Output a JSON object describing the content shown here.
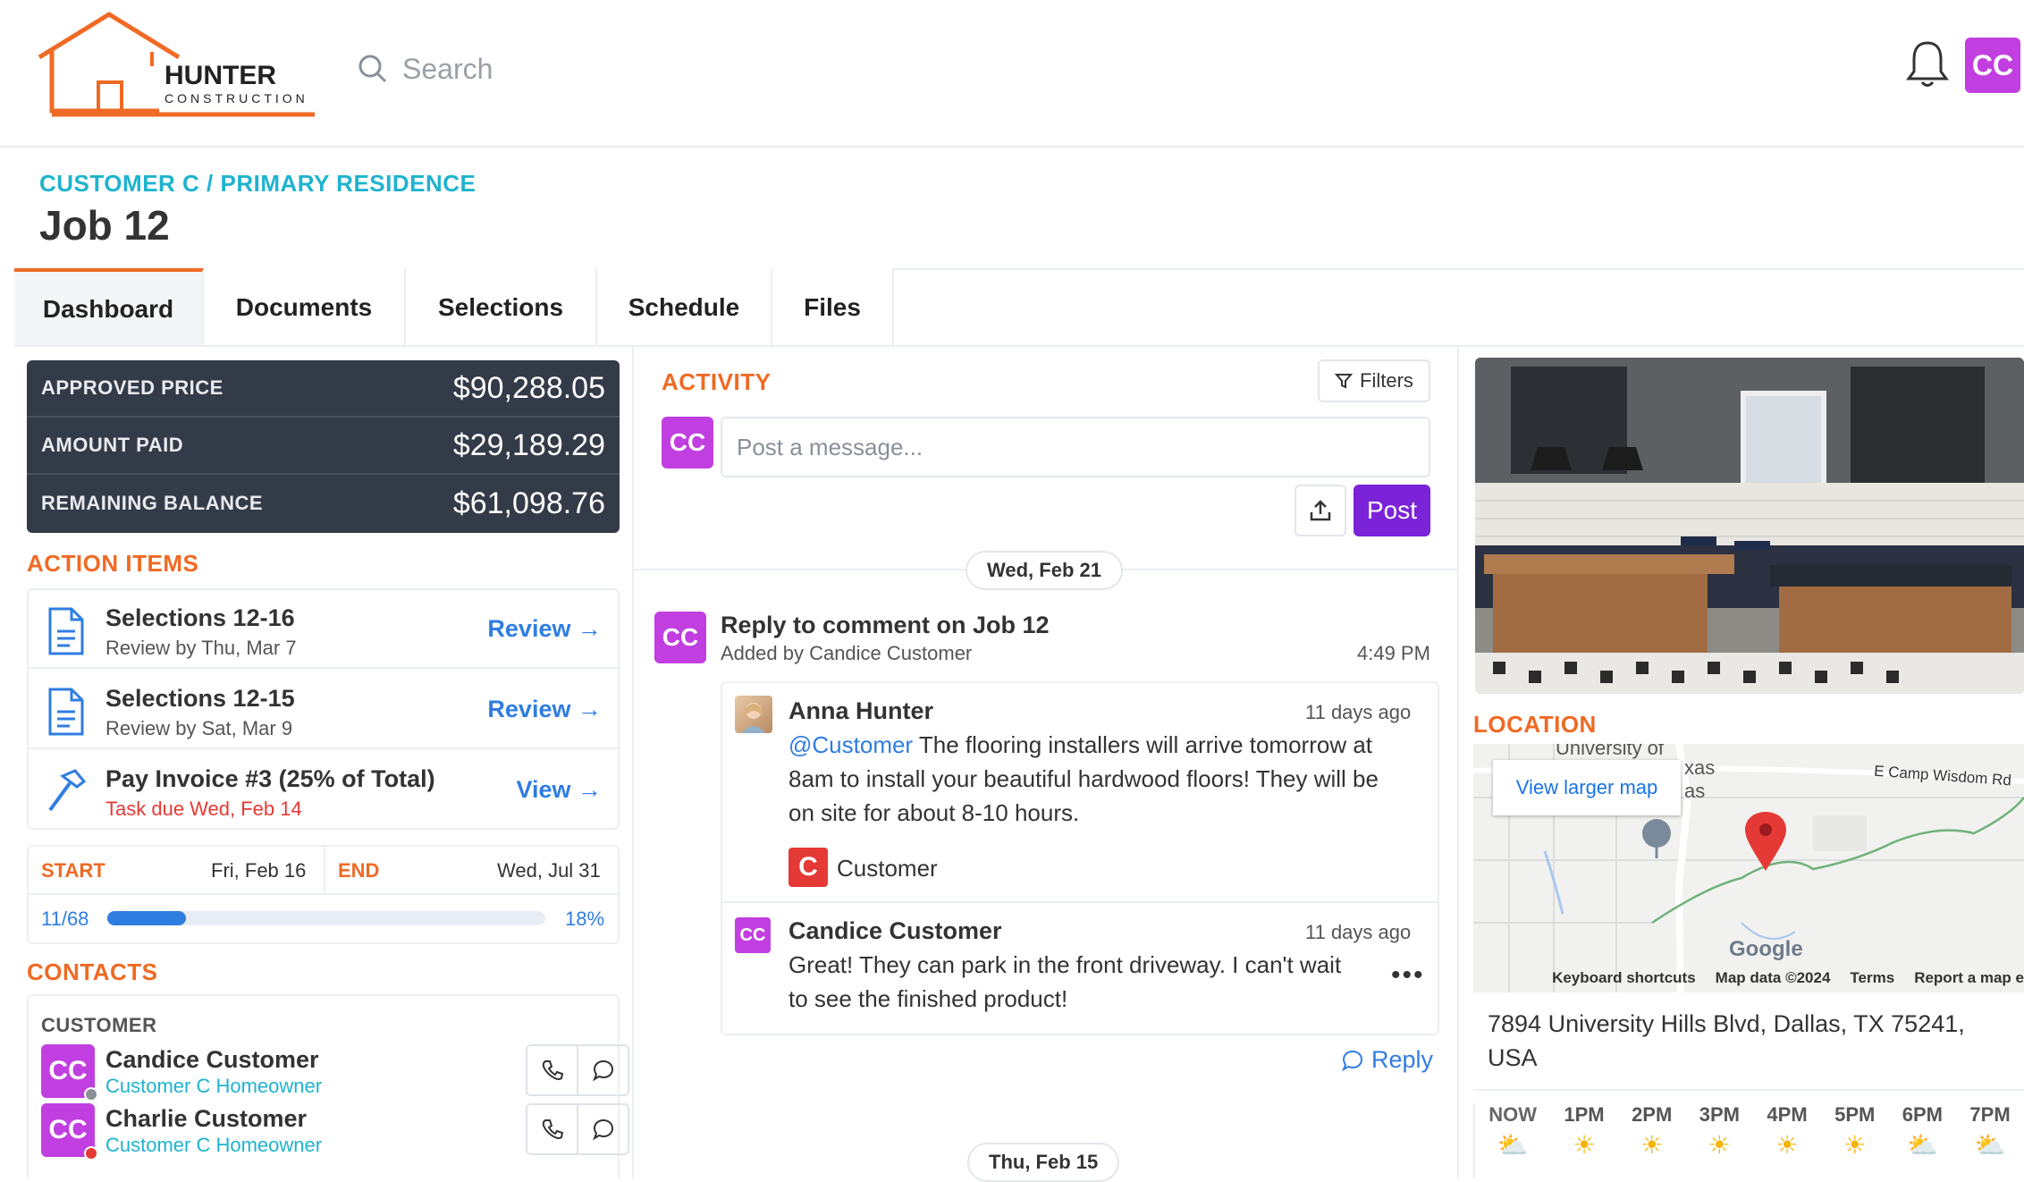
{
  "brand": {
    "name": "HUNTER",
    "tagline": "CONSTRUCTION",
    "accent": "#ef6a24"
  },
  "search": {
    "placeholder": "Search"
  },
  "user": {
    "initials": "CC"
  },
  "breadcrumb": "CUSTOMER C / PRIMARY RESIDENCE",
  "job_title": "Job 12",
  "tabs": [
    {
      "label": "Dashboard",
      "active": true
    },
    {
      "label": "Documents"
    },
    {
      "label": "Selections"
    },
    {
      "label": "Schedule"
    },
    {
      "label": "Files"
    }
  ],
  "finance": {
    "approved_label": "APPROVED PRICE",
    "approved_value": "$90,288.05",
    "paid_label": "AMOUNT PAID",
    "paid_value": "$29,189.29",
    "remaining_label": "REMAINING BALANCE",
    "remaining_value": "$61,098.76"
  },
  "action_items": {
    "heading": "ACTION ITEMS",
    "items": [
      {
        "title": "Selections 12-16",
        "sub": "Review by Thu, Mar 7",
        "link": "Review"
      },
      {
        "title": "Selections 12-15",
        "sub": "Review by Sat, Mar 9",
        "link": "Review"
      },
      {
        "title": "Pay Invoice #3 (25% of Total)",
        "sub": "Task due Wed, Feb 14",
        "link": "View"
      }
    ]
  },
  "schedule": {
    "start_label": "START",
    "start_date": "Fri, Feb 16",
    "end_label": "END",
    "end_date": "Wed, Jul 31",
    "tasks": "11/68",
    "percent": "18%",
    "progress": 0.18
  },
  "contacts": {
    "heading": "CONTACTS",
    "group": "CUSTOMER",
    "people": [
      {
        "initials": "CC",
        "name": "Candice Customer",
        "role": "Customer C Homeowner",
        "status_color": "#8a8f98"
      },
      {
        "initials": "CC",
        "name": "Charlie Customer",
        "role": "Customer C Homeowner",
        "status_color": "#e53935"
      }
    ]
  },
  "activity": {
    "heading": "ACTIVITY",
    "filters_label": "Filters",
    "post_avatar": "CC",
    "message_placeholder": "Post a message...",
    "post_label": "Post",
    "date_1": "Wed, Feb 21",
    "date_2": "Thu, Feb 15",
    "thread": {
      "avatar": "CC",
      "title": "Reply to comment on Job 12",
      "sub": "Added by Candice Customer",
      "time": "4:49 PM"
    },
    "comments": [
      {
        "name": "Anna Hunter",
        "when": "11 days ago",
        "mention": "@Customer",
        "body_l1": " The flooring installers will arrive tomorrow at",
        "body_l2": "8am to install your beautiful hardwood floors! They will be",
        "body_l3": "on site for about 8-10 hours.",
        "tag_initial": "C",
        "tag_label": "Customer"
      },
      {
        "name": "Candice Customer",
        "avatar": "CC",
        "when": "11 days ago",
        "body_l1": "Great! They can park in the front driveway. I can't wait",
        "body_l2": "to see the finished product!"
      }
    ],
    "reply_label": "Reply"
  },
  "location": {
    "heading": "LOCATION",
    "view_larger": "View larger map",
    "map_text_1": "University of",
    "map_text_2": "xas",
    "map_text_3": "as",
    "map_road": "E Camp Wisdom Rd",
    "map_google": "Google",
    "map_links": [
      "Keyboard shortcuts",
      "Map data ©2024",
      "Terms",
      "Report a map e"
    ],
    "address_l1": "7894 University Hills Blvd, Dallas, TX 75241,",
    "address_l2": "USA"
  },
  "weather": [
    {
      "hour": "NOW",
      "icon": "partly-cloudy-icon"
    },
    {
      "hour": "1PM",
      "icon": "sun-icon"
    },
    {
      "hour": "2PM",
      "icon": "sun-icon"
    },
    {
      "hour": "3PM",
      "icon": "sun-icon"
    },
    {
      "hour": "4PM",
      "icon": "sun-icon"
    },
    {
      "hour": "5PM",
      "icon": "sun-icon"
    },
    {
      "hour": "6PM",
      "icon": "partly-cloudy-icon"
    },
    {
      "hour": "7PM",
      "icon": "partly-cloudy-icon"
    }
  ]
}
